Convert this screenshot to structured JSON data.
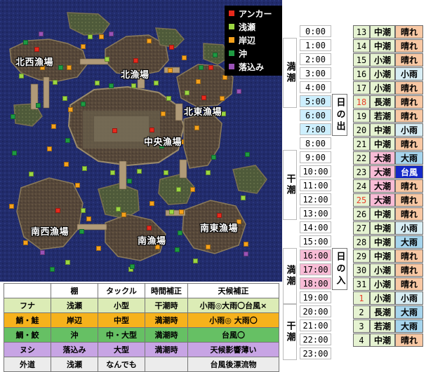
{
  "colors": {
    "anchor": "#e8291c",
    "shallow": "#9cd642",
    "shore": "#f6a11b",
    "offshore": "#1e9a42",
    "dropoff": "#9a52b6",
    "sea": "#202a66",
    "land": "#5a4a38"
  },
  "legend": [
    {
      "key": "anchor",
      "label": "アンカー"
    },
    {
      "key": "shallow",
      "label": "浅瀬"
    },
    {
      "key": "shore",
      "label": "岸辺"
    },
    {
      "key": "offshore",
      "label": "沖"
    },
    {
      "key": "dropoff",
      "label": "落込み"
    }
  ],
  "fishing_spots": [
    {
      "id": "northwest",
      "label": "北西漁場"
    },
    {
      "id": "north",
      "label": "北漁場"
    },
    {
      "id": "northeast",
      "label": "北東漁場"
    },
    {
      "id": "central",
      "label": "中央漁場"
    },
    {
      "id": "southwest",
      "label": "南西漁場"
    },
    {
      "id": "south",
      "label": "南漁場"
    },
    {
      "id": "southeast",
      "label": "南東漁場"
    }
  ],
  "tide_labels": {
    "high_1": "満潮",
    "low_1": "干潮",
    "high_2": "満潮",
    "low_2": "干潮"
  },
  "sun_labels": {
    "sunrise": "日の出",
    "sunset": "日の入"
  },
  "times": [
    {
      "t": "0:00",
      "bg": "#ffffff"
    },
    {
      "t": "1:00",
      "bg": "#ffffff"
    },
    {
      "t": "2:00",
      "bg": "#ffffff"
    },
    {
      "t": "3:00",
      "bg": "#ffffff"
    },
    {
      "t": "4:00",
      "bg": "#ffffff"
    },
    {
      "t": "5:00",
      "bg": "#cdeffe"
    },
    {
      "t": "6:00",
      "bg": "#cdeffe"
    },
    {
      "t": "7:00",
      "bg": "#cdeffe"
    },
    {
      "t": "8:00",
      "bg": "#ffffff"
    },
    {
      "t": "9:00",
      "bg": "#ffffff"
    },
    {
      "t": "10:00",
      "bg": "#ffffff"
    },
    {
      "t": "11:00",
      "bg": "#ffffff"
    },
    {
      "t": "12:00",
      "bg": "#ffffff"
    },
    {
      "t": "13:00",
      "bg": "#ffffff"
    },
    {
      "t": "14:00",
      "bg": "#ffffff"
    },
    {
      "t": "15:00",
      "bg": "#ffffff"
    },
    {
      "t": "16:00",
      "bg": "#f8bcd6"
    },
    {
      "t": "17:00",
      "bg": "#f8bcd6"
    },
    {
      "t": "18:00",
      "bg": "#f8bcd6"
    },
    {
      "t": "19:00",
      "bg": "#ffffff"
    },
    {
      "t": "20:00",
      "bg": "#ffffff"
    },
    {
      "t": "21:00",
      "bg": "#ffffff"
    },
    {
      "t": "22:00",
      "bg": "#ffffff"
    },
    {
      "t": "23:00",
      "bg": "#ffffff"
    }
  ],
  "days": [
    {
      "n": "13",
      "tide": "中潮",
      "weather": "晴れ",
      "nbg": "#e6f3d2",
      "nfg": "#000000",
      "tbg": "#e6f3d2",
      "tfg": "#000000",
      "wbg": "#f8c8a4",
      "wfg": "#000000"
    },
    {
      "n": "14",
      "tide": "中潮",
      "weather": "晴れ",
      "nbg": "#e6f3d2",
      "nfg": "#000000",
      "tbg": "#e6f3d2",
      "tfg": "#000000",
      "wbg": "#f8c8a4",
      "wfg": "#000000"
    },
    {
      "n": "15",
      "tide": "小潮",
      "weather": "晴れ",
      "nbg": "#e6f3d2",
      "nfg": "#000000",
      "tbg": "#e6f3d2",
      "tfg": "#000000",
      "wbg": "#f8c8a4",
      "wfg": "#000000"
    },
    {
      "n": "16",
      "tide": "小潮",
      "weather": "小雨",
      "nbg": "#e6f3d2",
      "nfg": "#000000",
      "tbg": "#e6f3d2",
      "tfg": "#000000",
      "wbg": "#d8edf4",
      "wfg": "#000000"
    },
    {
      "n": "17",
      "tide": "小潮",
      "weather": "晴れ",
      "nbg": "#e6f3d2",
      "nfg": "#000000",
      "tbg": "#e6f3d2",
      "tfg": "#000000",
      "wbg": "#f8c8a4",
      "wfg": "#000000"
    },
    {
      "n": "18",
      "tide": "長潮",
      "weather": "晴れ",
      "nbg": "#e6f3d2",
      "nfg": "#e8402a",
      "tbg": "#e6f3d2",
      "tfg": "#000000",
      "wbg": "#f8c8a4",
      "wfg": "#000000"
    },
    {
      "n": "19",
      "tide": "若潮",
      "weather": "晴れ",
      "nbg": "#e6f3d2",
      "nfg": "#000000",
      "tbg": "#e6f3d2",
      "tfg": "#000000",
      "wbg": "#f8c8a4",
      "wfg": "#000000"
    },
    {
      "n": "20",
      "tide": "中潮",
      "weather": "小雨",
      "nbg": "#e6f3d2",
      "nfg": "#000000",
      "tbg": "#e6f3d2",
      "tfg": "#000000",
      "wbg": "#d8edf4",
      "wfg": "#000000"
    },
    {
      "n": "21",
      "tide": "中潮",
      "weather": "晴れ",
      "nbg": "#e6f3d2",
      "nfg": "#000000",
      "tbg": "#e6f3d2",
      "tfg": "#000000",
      "wbg": "#f8c8a4",
      "wfg": "#000000"
    },
    {
      "n": "22",
      "tide": "大潮",
      "weather": "大雨",
      "nbg": "#e6f3d2",
      "nfg": "#000000",
      "tbg": "#f8bcd6",
      "tfg": "#000000",
      "wbg": "#a6d4ec",
      "wfg": "#000000"
    },
    {
      "n": "23",
      "tide": "大潮",
      "weather": "台風",
      "nbg": "#e6f3d2",
      "nfg": "#000000",
      "tbg": "#f8bcd6",
      "tfg": "#000000",
      "wbg": "#1428c8",
      "wfg": "#ffffff"
    },
    {
      "n": "24",
      "tide": "大潮",
      "weather": "晴れ",
      "nbg": "#e6f3d2",
      "nfg": "#000000",
      "tbg": "#f8bcd6",
      "tfg": "#000000",
      "wbg": "#f8c8a4",
      "wfg": "#000000"
    },
    {
      "n": "25",
      "tide": "大潮",
      "weather": "晴れ",
      "nbg": "#e6f3d2",
      "nfg": "#e8402a",
      "tbg": "#f8bcd6",
      "tfg": "#000000",
      "wbg": "#f8c8a4",
      "wfg": "#000000"
    },
    {
      "n": "26",
      "tide": "中潮",
      "weather": "晴れ",
      "nbg": "#e6f3d2",
      "nfg": "#000000",
      "tbg": "#e6f3d2",
      "tfg": "#000000",
      "wbg": "#f8c8a4",
      "wfg": "#000000"
    },
    {
      "n": "27",
      "tide": "中潮",
      "weather": "小雨",
      "nbg": "#e6f3d2",
      "nfg": "#000000",
      "tbg": "#e6f3d2",
      "tfg": "#000000",
      "wbg": "#d8edf4",
      "wfg": "#000000"
    },
    {
      "n": "28",
      "tide": "中潮",
      "weather": "大雨",
      "nbg": "#e6f3d2",
      "nfg": "#000000",
      "tbg": "#e6f3d2",
      "tfg": "#000000",
      "wbg": "#a6d4ec",
      "wfg": "#000000"
    },
    {
      "n": "29",
      "tide": "中潮",
      "weather": "晴れ",
      "nbg": "#e6f3d2",
      "nfg": "#000000",
      "tbg": "#e6f3d2",
      "tfg": "#000000",
      "wbg": "#f8c8a4",
      "wfg": "#000000"
    },
    {
      "n": "30",
      "tide": "小潮",
      "weather": "晴れ",
      "nbg": "#e6f3d2",
      "nfg": "#000000",
      "tbg": "#e6f3d2",
      "tfg": "#000000",
      "wbg": "#f8c8a4",
      "wfg": "#000000"
    },
    {
      "n": "31",
      "tide": "小潮",
      "weather": "晴れ",
      "nbg": "#e6f3d2",
      "nfg": "#000000",
      "tbg": "#e6f3d2",
      "tfg": "#000000",
      "wbg": "#f8c8a4",
      "wfg": "#000000"
    },
    {
      "n": "1",
      "tide": "小潮",
      "weather": "小雨",
      "nbg": "#e6f3d2",
      "nfg": "#e8402a",
      "tbg": "#e6f3d2",
      "tfg": "#000000",
      "wbg": "#d8edf4",
      "wfg": "#000000"
    },
    {
      "n": "2",
      "tide": "長潮",
      "weather": "大雨",
      "nbg": "#e6f3d2",
      "nfg": "#000000",
      "tbg": "#e6f3d2",
      "tfg": "#000000",
      "wbg": "#a6d4ec",
      "wfg": "#000000"
    },
    {
      "n": "3",
      "tide": "若潮",
      "weather": "大雨",
      "nbg": "#e6f3d2",
      "nfg": "#000000",
      "tbg": "#e6f3d2",
      "tfg": "#000000",
      "wbg": "#a6d4ec",
      "wfg": "#000000"
    },
    {
      "n": "4",
      "tide": "中潮",
      "weather": "晴れ",
      "nbg": "#e6f3d2",
      "nfg": "#000000",
      "tbg": "#e6f3d2",
      "tfg": "#000000",
      "wbg": "#f8c8a4",
      "wfg": "#000000"
    }
  ],
  "fish_table": {
    "headers": [
      "",
      "棚",
      "タックル",
      "時間補正",
      "天候補正"
    ],
    "rows": [
      {
        "cells": [
          "フナ",
          "浅瀬",
          "小型",
          "干潮時",
          "小雨◎大雨〇台風×"
        ],
        "bg": "#dcecb6"
      },
      {
        "cells": [
          "鮹・鮭",
          "岸辺",
          "中型",
          "満潮時",
          "小雨◎ 大雨〇"
        ],
        "bg": "#f6b21c"
      },
      {
        "cells": [
          "鯛・鮫",
          "沖",
          "中・大型",
          "満潮時",
          "台風〇"
        ],
        "bg": "#66c064"
      },
      {
        "cells": [
          "ヌシ",
          "落込み",
          "大型",
          "満潮時",
          "天候影響薄い"
        ],
        "bg": "#c7a4e4"
      },
      {
        "cells": [
          "外道",
          "浅瀬",
          "なんでも",
          "",
          "台風後漂流物"
        ],
        "bg": "#ececec"
      }
    ]
  }
}
